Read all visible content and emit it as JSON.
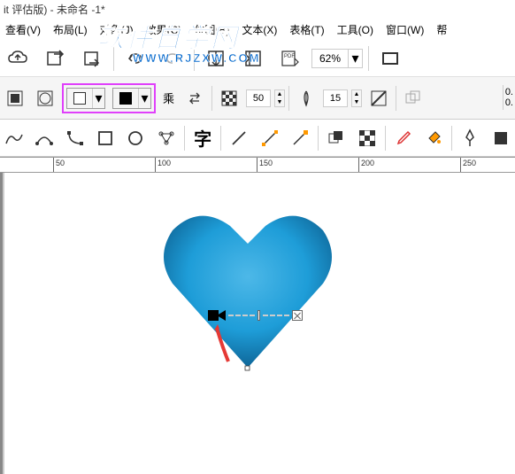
{
  "title": "it 评估版) - 未命名 -1*",
  "menu": {
    "view": "查看(V)",
    "layout": "布局(L)",
    "object": "对象(J)",
    "effect": "效果(C)",
    "bitmap": "位图(B)",
    "text": "文本(X)",
    "table": "表格(T)",
    "tools": "工具(O)",
    "window": "窗口(W)",
    "help": "帮"
  },
  "watermark": {
    "line1": "软件自学网",
    "line2": "WWW.RJZXW.COM"
  },
  "toolbar1": {
    "zoom": "62%"
  },
  "toolbar2": {
    "blend_mode": "乘",
    "opacity": "50",
    "feather": "15",
    "percent_stack": "0.\n0."
  },
  "toolbar3": {
    "text_btn": "字"
  },
  "ruler": {
    "marks": [
      "50",
      "100",
      "150",
      "200",
      "250"
    ]
  }
}
